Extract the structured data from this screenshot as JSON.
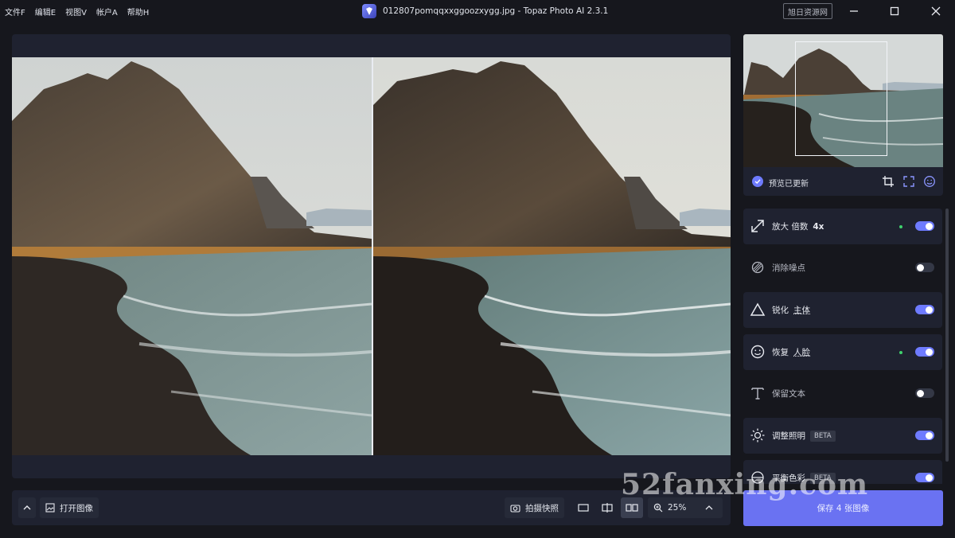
{
  "menu": [
    "文件F",
    "编辑E",
    "视图V",
    "帐户A",
    "帮助H"
  ],
  "window": {
    "title": "012807pomqqxxggoozxygg.jpg - Topaz Photo AI 2.3.1",
    "watermark_box": "旭日资源网"
  },
  "preview": {
    "status": "预览已更新"
  },
  "features": [
    {
      "label": "放大 倍数",
      "extra": "4x",
      "enabled": true,
      "dot": true,
      "icon": "upscale-arrow-icon"
    },
    {
      "label": "消除噪点",
      "enabled": false,
      "dot": false,
      "icon": "denoise-icon"
    },
    {
      "label": "锐化",
      "extra": "主体",
      "enabled": true,
      "dot": false,
      "icon": "sharpen-triangle-icon"
    },
    {
      "label": "恢复",
      "extra": "人脸",
      "enabled": true,
      "dot": true,
      "icon": "face-icon"
    },
    {
      "label": "保留文本",
      "enabled": false,
      "dot": false,
      "icon": "text-icon"
    },
    {
      "label": "调整照明",
      "badge": "BETA",
      "enabled": true,
      "dot": false,
      "icon": "sun-icon"
    },
    {
      "label": "平衡色彩",
      "badge": "BETA",
      "enabled": true,
      "dot": false,
      "icon": "color-balance-icon"
    }
  ],
  "bottombar": {
    "open_image": "打开图像",
    "snapshot": "拍摄快照",
    "zoom": "25%"
  },
  "save_button": "保存 4 张图像",
  "site_watermark": "52fanxing.com",
  "colors": {
    "accent": "#6e7bff",
    "save": "#6a72f2",
    "status_dot": "#3fd16c",
    "panel": "#1f2230",
    "background": "#16171d"
  }
}
